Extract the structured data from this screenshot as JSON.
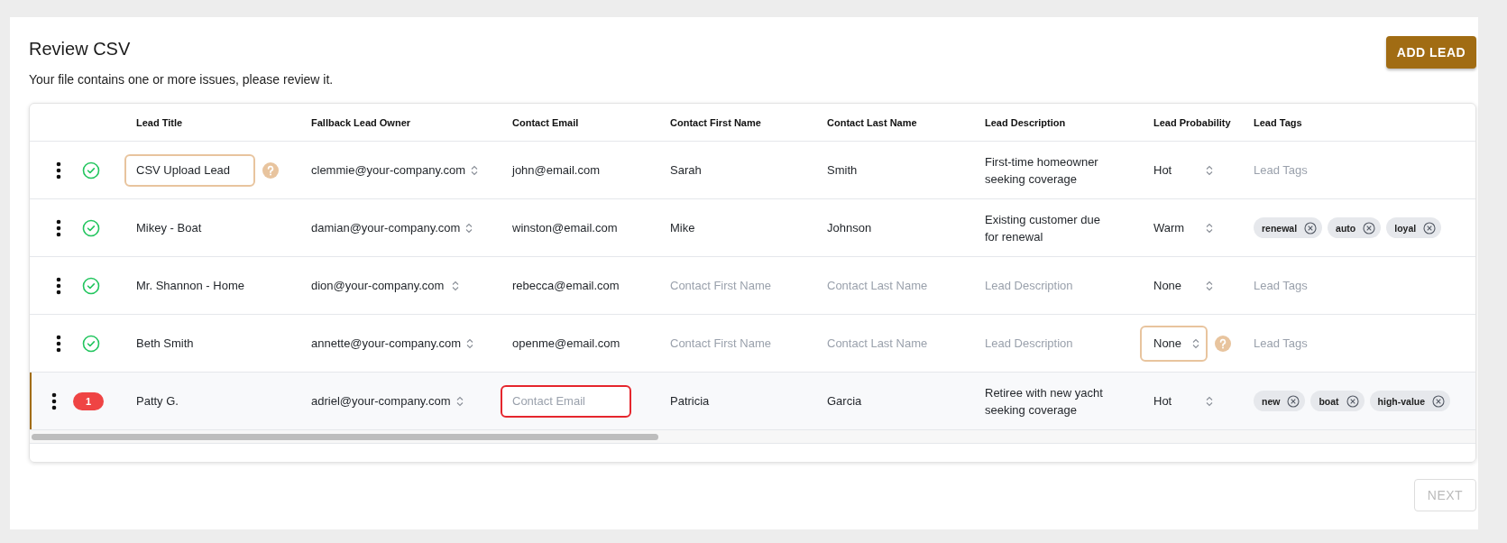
{
  "header": {
    "title": "Review CSV",
    "subtitle": "Your file contains one or more issues, please review it.",
    "add_button": "ADD LEAD"
  },
  "table": {
    "columns": [
      "Lead Title",
      "Fallback Lead Owner",
      "Contact Email",
      "Contact First Name",
      "Contact Last Name",
      "Lead Description",
      "Lead Probability",
      "Lead Tags"
    ],
    "rows": [
      {
        "selected": false,
        "valid": true,
        "title": {
          "value": "CSV Upload Lead",
          "warning": true
        },
        "owner": "clemmie@your-company.com",
        "email": {
          "value": "john@email.com",
          "invalid": false
        },
        "first_name": {
          "value": "Sarah"
        },
        "last_name": {
          "value": "Smith"
        },
        "description": {
          "value": "First-time homeowner seeking coverage"
        },
        "probability": {
          "value": "Hot",
          "warning": false
        },
        "tags": {
          "placeholder": "Lead Tags"
        }
      },
      {
        "selected": false,
        "valid": true,
        "title": {
          "value": "Mikey - Boat",
          "warning": false
        },
        "owner": "damian@your-company.com",
        "email": {
          "value": "winston@email.com",
          "invalid": false
        },
        "first_name": {
          "value": "Mike"
        },
        "last_name": {
          "value": "Johnson"
        },
        "description": {
          "value": "Existing customer due for renewal"
        },
        "probability": {
          "value": "Warm",
          "warning": false
        },
        "tags": {
          "items": [
            "renewal",
            "auto",
            "loyal"
          ]
        }
      },
      {
        "selected": false,
        "valid": true,
        "title": {
          "value": "Mr. Shannon - Home",
          "warning": false
        },
        "owner": "dion@your-company.com",
        "email": {
          "value": "rebecca@email.com",
          "invalid": false
        },
        "first_name": {
          "placeholder": "Contact First Name"
        },
        "last_name": {
          "placeholder": "Contact Last Name"
        },
        "description": {
          "placeholder": "Lead Description"
        },
        "probability": {
          "value": "None",
          "warning": false
        },
        "tags": {
          "placeholder": "Lead Tags"
        }
      },
      {
        "selected": false,
        "valid": true,
        "title": {
          "value": "Beth Smith",
          "warning": false
        },
        "owner": "annette@your-company.com",
        "email": {
          "value": "openme@email.com",
          "invalid": false
        },
        "first_name": {
          "placeholder": "Contact First Name"
        },
        "last_name": {
          "placeholder": "Contact Last Name"
        },
        "description": {
          "placeholder": "Lead Description"
        },
        "probability": {
          "value": "None",
          "warning": true
        },
        "tags": {
          "placeholder": "Lead Tags"
        }
      },
      {
        "selected": true,
        "valid": false,
        "error_count": "1",
        "title": {
          "value": "Patty G.",
          "warning": false
        },
        "owner": "adriel@your-company.com",
        "email": {
          "placeholder": "Contact Email",
          "invalid": true
        },
        "first_name": {
          "value": "Patricia"
        },
        "last_name": {
          "value": "Garcia"
        },
        "description": {
          "value": "Retiree with new yacht seeking coverage"
        },
        "probability": {
          "value": "Hot",
          "warning": false
        },
        "tags": {
          "items": [
            "new",
            "boat",
            "high-value"
          ]
        }
      }
    ]
  },
  "footer": {
    "next_button": {
      "label": "NEXT",
      "disabled": true
    }
  }
}
